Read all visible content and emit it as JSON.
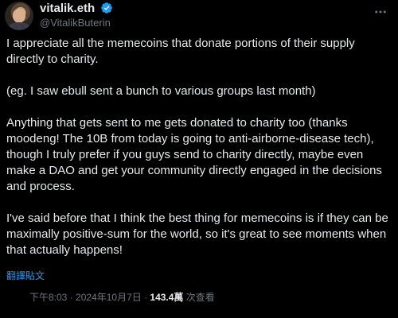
{
  "tweet": {
    "display_name": "vitalik.eth",
    "handle": "@VitalikButerin",
    "more_icon": "more-horizontal-icon",
    "verified_icon": "verified-badge-icon",
    "paragraphs": [
      "I appreciate all the memecoins that donate portions of their supply\ndirectly to charity.",
      "(eg. I saw ebull sent a bunch to various groups last month)",
      "Anything that gets sent to me gets donated to charity too (thanks\nmoodeng! The 10B from today is going to anti-airborne-disease tech),\nthough I truly prefer if you guys send to charity directly, maybe even\nmake a DAO and get your community directly engaged in the decisions\nand process.",
      "I've said before that I think the best thing for memecoins is if they can be\nmaximally positive-sum for the world, so it's great to see moments when\nthat actually happens!"
    ],
    "translate_label": "翻譯貼文",
    "timestamp": "下午8:03 · 2024年10月7日 · ",
    "views_count": "143.4萬",
    "views_label": " 次查看"
  },
  "colors": {
    "background": "#000000",
    "text": "#e7e9ea",
    "secondary": "#71767b",
    "accent": "#1d9bf0"
  }
}
